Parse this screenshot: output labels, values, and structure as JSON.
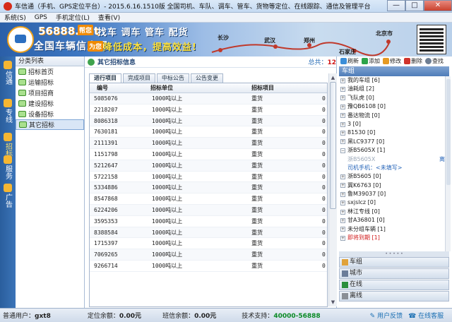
{
  "title": "车信通（手机、GPS定位平台）- 2015.6.16.1510版 全国司机、车队、调车、管车、货物等定位、在线跟踪、通信及管理平台",
  "window_controls": {
    "minimize": "—",
    "maximize": "□",
    "close": "✕"
  },
  "menu": [
    "系统(S)",
    "GPS",
    "手机定位(L)",
    "查看(V)"
  ],
  "banner": {
    "site": "56888.net",
    "site_sub": "全国车辆信息网",
    "tag1": "帮您",
    "slogan1": "找车 调车 管车 配货",
    "tag2": "为您",
    "slogan2": "降低成本，提高效益!",
    "cities": [
      "长沙",
      "武汉",
      "郑州",
      "石家庄",
      "北京市"
    ]
  },
  "left_rail": [
    {
      "label": "信通",
      "icon": "chat-icon"
    },
    {
      "label": "专线",
      "icon": "route-icon"
    },
    {
      "label": "招标",
      "icon": "bid-icon",
      "active": true
    },
    {
      "label": "服务",
      "icon": "service-icon"
    },
    {
      "label": "广告",
      "icon": "ad-icon"
    }
  ],
  "category_panel": {
    "title": "分类列表",
    "items": [
      "招标首页",
      "运输招标",
      "项目招商",
      "建设招标",
      "设备招标",
      "其它招标"
    ],
    "selected_index": 5
  },
  "main": {
    "title": "其它招标信息",
    "total_label": "总共：",
    "total_value": "12",
    "tabs": [
      "进行项目",
      "完成项目",
      "中标公告",
      "公告变更"
    ],
    "active_tab": 0,
    "columns": [
      "编号",
      "招标单位",
      "招标项目",
      ""
    ],
    "rows": [
      [
        "5085076",
        "1000吨以上",
        "重货",
        "0"
      ],
      [
        "2218207",
        "1000吨以上",
        "重货",
        "0"
      ],
      [
        "8086318",
        "1000吨以上",
        "重货",
        "0"
      ],
      [
        "7630181",
        "1000吨以上",
        "重货",
        "0"
      ],
      [
        "2111391",
        "1000吨以上",
        "重货",
        "0"
      ],
      [
        "1151798",
        "1000吨以上",
        "重货",
        "0"
      ],
      [
        "5212647",
        "1000吨以上",
        "重货",
        "0"
      ],
      [
        "5722158",
        "1000吨以上",
        "重货",
        "0"
      ],
      [
        "5334886",
        "1000吨以上",
        "重货",
        "0"
      ],
      [
        "8547868",
        "1000吨以上",
        "重货",
        "0"
      ],
      [
        "6224206",
        "1000吨以上",
        "重货",
        "0"
      ],
      [
        "3595353",
        "1000吨以上",
        "重货",
        "0"
      ],
      [
        "8388584",
        "1000吨以上",
        "重货",
        "0"
      ],
      [
        "1715397",
        "1000吨以上",
        "重货",
        "0"
      ],
      [
        "7069265",
        "1000吨以上",
        "重货",
        "0"
      ],
      [
        "9266714",
        "1000吨以上",
        "重货",
        "0"
      ]
    ]
  },
  "right": {
    "toolbar": [
      "刷新",
      "添加",
      "修改",
      "删除",
      "查找"
    ],
    "group_title": "车组",
    "tree": [
      {
        "label": "我的车组 [6]",
        "kind": "group"
      },
      {
        "label": "油耗组 [2]",
        "kind": "group"
      },
      {
        "label": "飞队虎 [0]",
        "kind": "group"
      },
      {
        "label": "豫QB6108 [0]",
        "kind": "group"
      },
      {
        "label": "番达物流 [0]",
        "kind": "group"
      },
      {
        "label": "3 [0]",
        "kind": "group"
      },
      {
        "label": "81530 [0]",
        "kind": "group"
      },
      {
        "label": "黑LC9377 [0]",
        "kind": "group"
      },
      {
        "label": "浙B5605X [1]",
        "kind": "group-open"
      },
      {
        "label": "浙B5605X",
        "kind": "vehicle",
        "state": "离线"
      },
      {
        "label": "司机手机：<未填写>",
        "kind": "vehicle-info"
      },
      {
        "label": "浙B5605 [0]",
        "kind": "group"
      },
      {
        "label": "冀K6763 [0]",
        "kind": "group"
      },
      {
        "label": "鲁M39037 [0]",
        "kind": "group"
      },
      {
        "label": "sxjslcz [0]",
        "kind": "group"
      },
      {
        "label": "林江专线 [0]",
        "kind": "group"
      },
      {
        "label": "甘A36801 [0]",
        "kind": "group"
      },
      {
        "label": "未分组车辆 [1]",
        "kind": "group"
      },
      {
        "label": "即将到期 [1]",
        "kind": "alert"
      }
    ],
    "bottom_buttons": [
      "车组",
      "城市",
      "在线",
      "离线"
    ]
  },
  "status": {
    "user_label": "普通用户：",
    "user": "gxt8",
    "locate_label": "定位余额：",
    "locate": "0.00元",
    "shift_label": "班信余额：",
    "shift": "0.00元",
    "support_label": "技术支持：",
    "support": "40000-56888",
    "feedback": "用户反馈",
    "online_service": "在线客服"
  },
  "colors": {
    "accent_blue": "#2b5fa8",
    "rail": "#3b74b8",
    "alert": "#d01818",
    "support_green": "#0a8a25"
  }
}
